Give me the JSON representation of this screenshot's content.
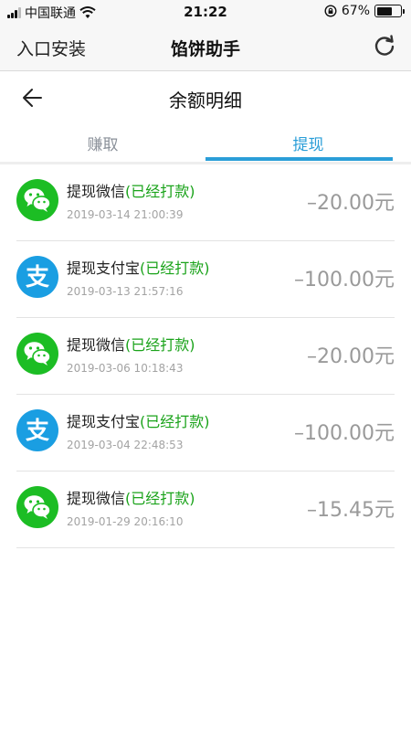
{
  "status_bar": {
    "carrier": "中国联通",
    "time": "21:22",
    "battery": "67%",
    "battery_level": 0.67
  },
  "app_header": {
    "entry_label": "入口安装",
    "title": "馅饼助手",
    "refresh_icon": "refresh-icon"
  },
  "page_header": {
    "back_icon": "back-arrow-icon",
    "title": "余额明细"
  },
  "tabs": [
    {
      "label": "赚取",
      "active": false
    },
    {
      "label": "提现",
      "active": true
    }
  ],
  "colors": {
    "accent": "#2a9ed8",
    "status_green": "#1aa31a",
    "wechat": "#1cbd24",
    "alipay": "#1a9ee2"
  },
  "records": [
    {
      "icon": "wechat-icon",
      "label": "提现微信",
      "status": "(已经打款)",
      "time": "2019-03-14 21:00:39",
      "amount": "–20.00元"
    },
    {
      "icon": "alipay-icon",
      "label": "提现支付宝",
      "status": "(已经打款)",
      "time": "2019-03-13 21:57:16",
      "amount": "–100.00元"
    },
    {
      "icon": "wechat-icon",
      "label": "提现微信",
      "status": "(已经打款)",
      "time": "2019-03-06 10:18:43",
      "amount": "–20.00元"
    },
    {
      "icon": "alipay-icon",
      "label": "提现支付宝",
      "status": "(已经打款)",
      "time": "2019-03-04 22:48:53",
      "amount": "–100.00元"
    },
    {
      "icon": "wechat-icon",
      "label": "提现微信",
      "status": "(已经打款)",
      "time": "2019-01-29 20:16:10",
      "amount": "–15.45元"
    }
  ]
}
